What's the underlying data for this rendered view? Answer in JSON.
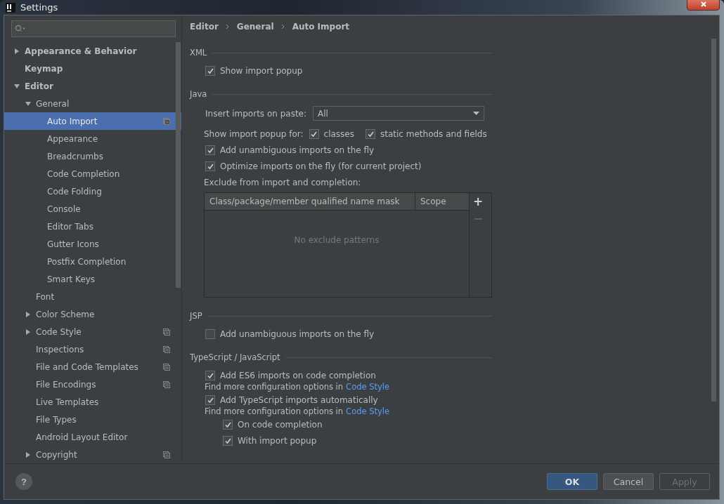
{
  "window": {
    "title": "Settings"
  },
  "tree": [
    {
      "label": "Appearance & Behavior",
      "expanded": false,
      "selected": false,
      "project": false
    },
    {
      "label": "Keymap",
      "selected": false,
      "project": false
    },
    {
      "label": "Editor",
      "expanded": true,
      "selected": false,
      "project": false,
      "children": [
        {
          "label": "General",
          "expanded": true,
          "selected": false,
          "project": false,
          "children": [
            {
              "label": "Auto Import",
              "selected": true,
              "project": true
            },
            {
              "label": "Appearance",
              "selected": false,
              "project": false
            },
            {
              "label": "Breadcrumbs",
              "selected": false,
              "project": false
            },
            {
              "label": "Code Completion",
              "selected": false,
              "project": false
            },
            {
              "label": "Code Folding",
              "selected": false,
              "project": false
            },
            {
              "label": "Console",
              "selected": false,
              "project": false
            },
            {
              "label": "Editor Tabs",
              "selected": false,
              "project": false
            },
            {
              "label": "Gutter Icons",
              "selected": false,
              "project": false
            },
            {
              "label": "Postfix Completion",
              "selected": false,
              "project": false
            },
            {
              "label": "Smart Keys",
              "selected": false,
              "project": false
            }
          ]
        },
        {
          "label": "Font",
          "selected": false,
          "project": false
        },
        {
          "label": "Color Scheme",
          "expanded": false,
          "selected": false,
          "project": false
        },
        {
          "label": "Code Style",
          "expanded": false,
          "selected": false,
          "project": true
        },
        {
          "label": "Inspections",
          "selected": false,
          "project": true
        },
        {
          "label": "File and Code Templates",
          "selected": false,
          "project": true
        },
        {
          "label": "File Encodings",
          "selected": false,
          "project": true
        },
        {
          "label": "Live Templates",
          "selected": false,
          "project": false
        },
        {
          "label": "File Types",
          "selected": false,
          "project": false
        },
        {
          "label": "Android Layout Editor",
          "selected": false,
          "project": false
        },
        {
          "label": "Copyright",
          "expanded": false,
          "selected": false,
          "project": true
        }
      ]
    }
  ],
  "breadcrumb": [
    "Editor",
    "General",
    "Auto Import"
  ],
  "sections": [
    {
      "title": "XML",
      "rows": [
        {
          "kind": "checkbox",
          "label": "Show import popup",
          "checked": true
        }
      ]
    },
    {
      "title": "Java",
      "rows": [
        {
          "kind": "dropdown",
          "label": "Insert imports on paste:",
          "value": "All"
        },
        {
          "kind": "checkgroup",
          "label": "Show import popup for:",
          "options": [
            {
              "label": "classes",
              "checked": true
            },
            {
              "label": "static methods and fields",
              "checked": true
            }
          ]
        },
        {
          "kind": "checkbox",
          "label": "Add unambiguous imports on the fly",
          "checked": true
        },
        {
          "kind": "checkbox",
          "label": "Optimize imports on the fly (for current project)",
          "checked": true
        },
        {
          "kind": "text",
          "label": "Exclude from import and completion:"
        },
        {
          "kind": "table",
          "columns": [
            "Class/package/member qualified name mask",
            "Scope"
          ],
          "empty_text": "No exclude patterns",
          "tools": [
            {
              "symbol": "+",
              "disabled": false
            },
            {
              "symbol": "−",
              "disabled": true
            }
          ]
        }
      ]
    },
    {
      "title": "JSP",
      "rows": [
        {
          "kind": "checkbox",
          "label": "Add unambiguous imports on the fly",
          "checked": false
        }
      ]
    },
    {
      "title": "TypeScript / JavaScript",
      "rows": [
        {
          "kind": "checkbox",
          "label": "Add ES6 imports on code completion",
          "checked": true
        },
        {
          "kind": "note",
          "text": "Find more configuration options in",
          "link": "Code Style"
        },
        {
          "kind": "checkbox",
          "label": "Add TypeScript imports automatically",
          "checked": true
        },
        {
          "kind": "note",
          "text": "Find more configuration options in",
          "link": "Code Style"
        },
        {
          "kind": "group",
          "rows": [
            {
              "kind": "checkbox",
              "label": "On code completion",
              "checked": true
            },
            {
              "kind": "checkbox",
              "label": "With import popup",
              "checked": true
            }
          ]
        }
      ]
    }
  ],
  "buttons": [
    {
      "label": "OK",
      "default": true,
      "disabled": false
    },
    {
      "label": "Cancel",
      "default": false,
      "disabled": false
    },
    {
      "label": "Apply",
      "default": false,
      "disabled": true
    }
  ],
  "help": "?"
}
